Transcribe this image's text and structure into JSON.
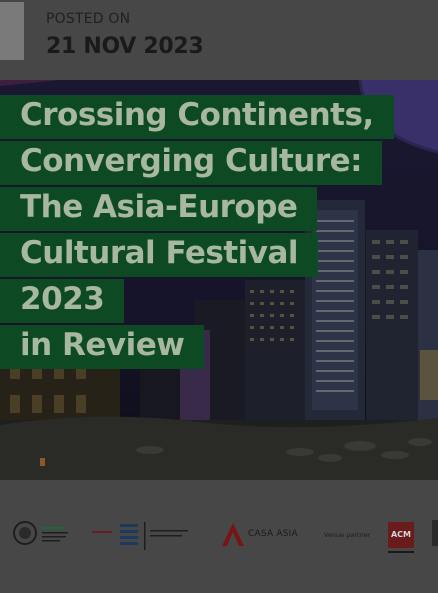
{
  "post": {
    "posted_label": "POSTED ON",
    "date": "21 NOV 2023"
  },
  "article": {
    "title_lines": [
      "Crossing Continents,",
      "Converging Culture:",
      "The Asia-Europe",
      "Cultural Festival 2023",
      "in Review"
    ]
  },
  "partners": {
    "casa_asia_label": "CASA ASIA",
    "venue_partner_label": "Venue partner",
    "acm_label": "ACM"
  },
  "colors": {
    "page_overlay": "#474747",
    "title_background": "#0d4a24",
    "title_text": "#a7b7a0",
    "accent_bar": "#7a7a7a"
  }
}
